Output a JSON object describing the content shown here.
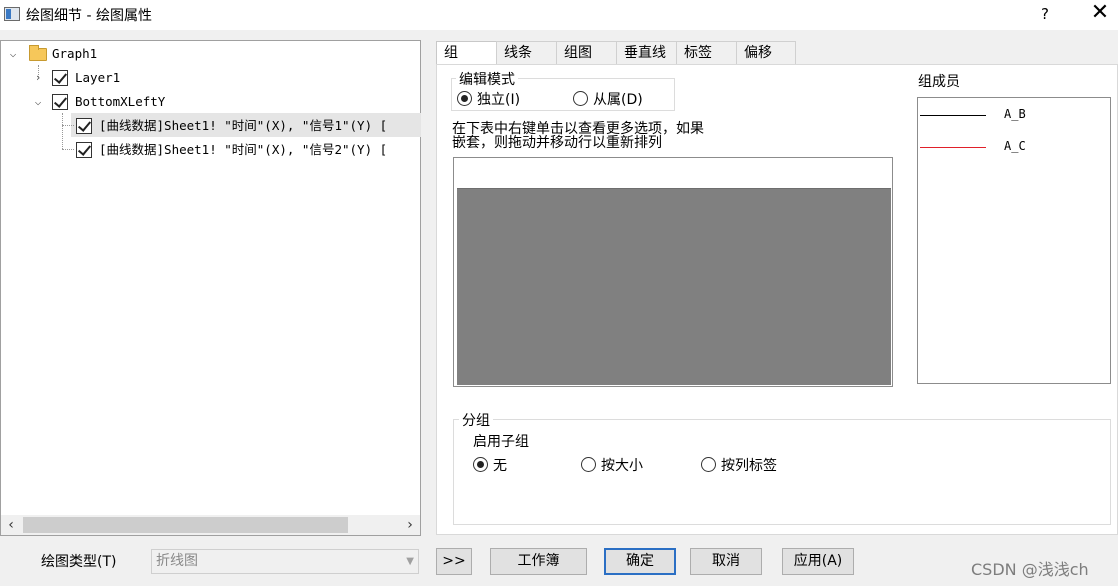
{
  "window": {
    "title": "绘图细节 - 绘图属性",
    "help": "?",
    "close": "✕"
  },
  "tree": {
    "root": "Graph1",
    "layer": "Layer1",
    "axis": "BottomXLeftY",
    "curves": [
      "[曲线数据]Sheet1! \"时间\"(X), \"信号1\"(Y) [",
      "[曲线数据]Sheet1! \"时间\"(X), \"信号2\"(Y) ["
    ]
  },
  "tabs": [
    "组",
    "线条",
    "组图",
    "垂直线",
    "标签",
    "偏移"
  ],
  "group_tab": {
    "edit_mode_title": "编辑模式",
    "independent": "独立(I)",
    "dependent": "从属(D)",
    "help_line1": "在下表中右键单击以查看更多选项，如果",
    "help_line2": "嵌套，则拖动并移动行以重新排列",
    "members_title": "组成员",
    "members": [
      {
        "name": "A_B",
        "color": "#000000"
      },
      {
        "name": "A_C",
        "color": "#e0202a"
      }
    ],
    "grouping_title": "分组",
    "enable_subgroup": "启用子组",
    "subgroup_options": [
      "无",
      "按大小",
      "按列标签"
    ]
  },
  "footer": {
    "plot_type_label": "绘图类型(T)",
    "plot_type_value": "折线图",
    "expand": ">>",
    "workbook": "工作簿",
    "ok": "确定",
    "cancel": "取消",
    "apply": "应用(A)"
  },
  "watermark": "CSDN @浅浅ch"
}
